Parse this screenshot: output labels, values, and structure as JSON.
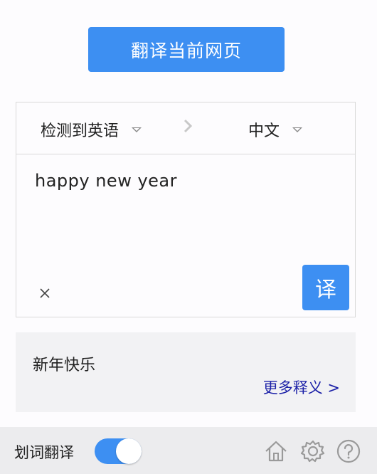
{
  "header": {
    "translate_page_label": "翻译当前网页"
  },
  "translator": {
    "source_lang": "检测到英语",
    "target_lang": "中文",
    "input_value": "happy new year",
    "translate_button_label": "译"
  },
  "result": {
    "text": "新年快乐",
    "more_label": "更多释义 >"
  },
  "footer": {
    "word_translate_label": "划词翻译",
    "word_translate_enabled": true
  },
  "icons": [
    "chevron-down-icon",
    "chevron-right-icon",
    "close-icon",
    "home-icon",
    "gear-icon",
    "help-icon"
  ],
  "colors": {
    "accent": "#3d8ff2",
    "link": "#1d22a8"
  }
}
